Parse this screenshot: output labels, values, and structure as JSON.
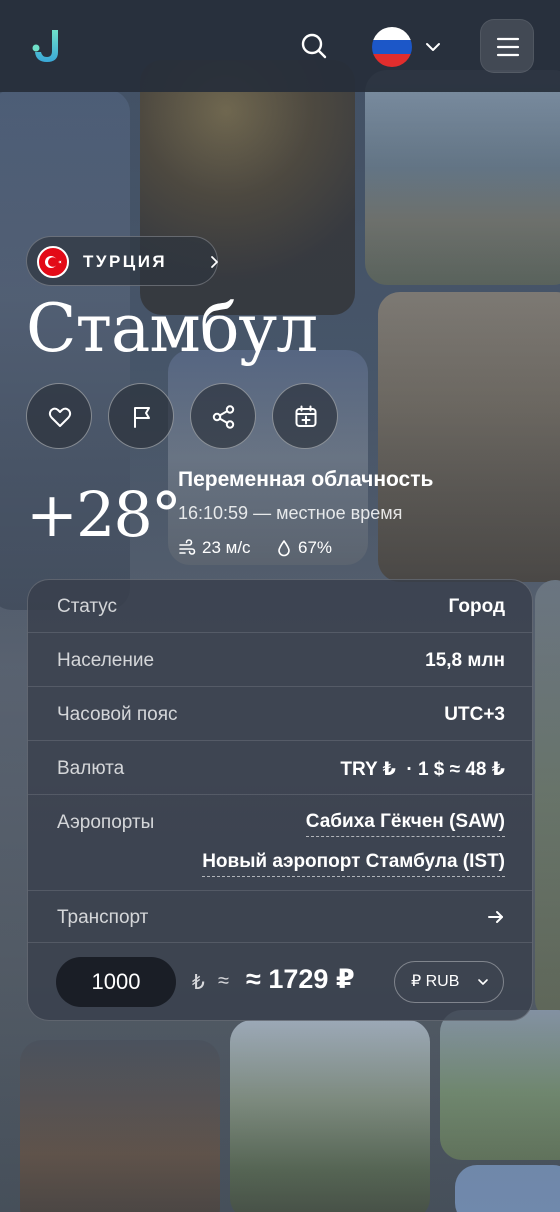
{
  "header": {
    "logo_icon": "logo-j-icon",
    "search_icon": "search-icon",
    "language_flag": "russia-flag",
    "menu_icon": "hamburger-icon"
  },
  "country": {
    "name": "ТУРЦИЯ",
    "flag": "turkey-flag"
  },
  "city": "Стамбул",
  "actions": [
    "heart-icon",
    "flag-icon",
    "share-icon",
    "calendar-add-icon"
  ],
  "weather": {
    "temperature": "+28°",
    "description": "Переменная облачность",
    "local_time": "16:10:59 — местное время",
    "wind": "23 м/с",
    "humidity": "67%"
  },
  "info": {
    "status": {
      "label": "Статус",
      "value": "Город"
    },
    "population": {
      "label": "Население",
      "value": "15,8 млн"
    },
    "timezone": {
      "label": "Часовой пояс",
      "value": "UTC+3"
    },
    "currency": {
      "label": "Валюта",
      "value": "TRY ₺  · 1 $ ≈ 48 ₺"
    },
    "airports": {
      "label": "Аэропорты",
      "values": [
        "Сабиха Гёкчен (SAW)",
        "Новый аэропорт Стамбула (IST)"
      ]
    },
    "transport": {
      "label": "Транспорт"
    }
  },
  "converter": {
    "amount": "1000",
    "from_symbol": "₺",
    "approx": "≈",
    "result": "≈ 1729 ₽",
    "target": "₽ RUB"
  },
  "colors": {
    "header_bg": "#262e3a",
    "turkey_red": "#e30a17",
    "logo_teal": "#5bc8d6"
  }
}
